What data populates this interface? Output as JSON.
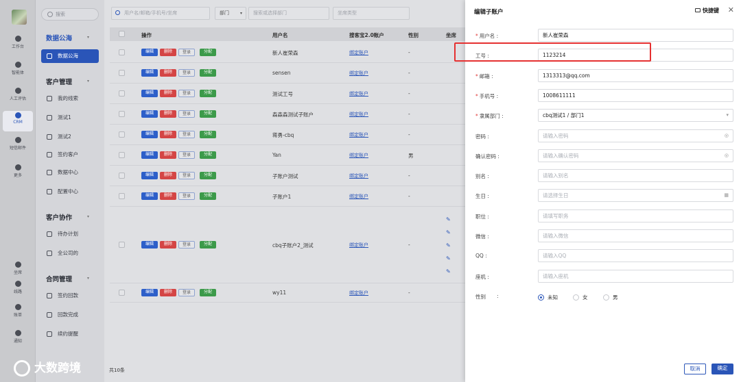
{
  "rail": {
    "items": [
      {
        "label": "工作台",
        "icon": "workbench-icon"
      },
      {
        "label": "智能体",
        "icon": "agent-icon"
      },
      {
        "label": "人工评估",
        "icon": "review-icon"
      },
      {
        "label": "CRM",
        "icon": "crm-icon"
      },
      {
        "label": "短信邮件",
        "icon": "message-icon"
      },
      {
        "label": "更多",
        "icon": "more-icon"
      },
      {
        "label": "坐席",
        "icon": "headset-icon"
      },
      {
        "label": "线路",
        "icon": "route-icon"
      },
      {
        "label": "账单",
        "icon": "bill-icon"
      },
      {
        "label": "通知",
        "icon": "bell-icon"
      }
    ]
  },
  "nav": {
    "search_placeholder": "搜索",
    "sections": [
      {
        "title": "数据公海",
        "items": [
          "数据公海"
        ]
      },
      {
        "title": "客户管理",
        "items": [
          "我的线索",
          "测试1",
          "测试2",
          "签约客户",
          "数据中心",
          "配置中心"
        ]
      },
      {
        "title": "客户协作",
        "items": [
          "待办计划",
          "全公司的"
        ]
      },
      {
        "title": "合同管理",
        "items": [
          "签约回款",
          "回款完成",
          "续约提醒"
        ]
      }
    ]
  },
  "filters": {
    "user_placeholder": "用户名/邮箱/手机号/坐席",
    "dept_label": "部门",
    "dept_placeholder": "搜索或选择部门",
    "seat_placeholder": "坐席类型"
  },
  "table": {
    "headers": [
      "操作",
      "用户名",
      "搜客宝2.0账户",
      "性别",
      "坐席"
    ],
    "buttons": {
      "edit": "编辑",
      "delete": "删除",
      "login": "登录",
      "assign": "分配"
    },
    "rows": [
      {
        "username": "新人崔荣森",
        "account": "绑定账户",
        "gender": "-"
      },
      {
        "username": "sensen",
        "account": "绑定账户",
        "gender": "-"
      },
      {
        "username": "测试工号",
        "account": "绑定账户",
        "gender": "-"
      },
      {
        "username": "森森森测试子账户",
        "account": "绑定账户",
        "gender": "-"
      },
      {
        "username": "蒋勇-cbq",
        "account": "绑定账户",
        "gender": "-"
      },
      {
        "username": "Yan",
        "account": "绑定账户",
        "gender": "男"
      },
      {
        "username": "子账户测试",
        "account": "绑定账户",
        "gender": "-"
      },
      {
        "username": "子账户1",
        "account": "绑定账户",
        "gender": "-"
      },
      {
        "username": "cbq子账户2_测试",
        "account": "绑定账户",
        "gender": "-"
      },
      {
        "username": "wy11",
        "account": "绑定账户",
        "gender": "-"
      }
    ],
    "total": "共10条"
  },
  "drawer": {
    "title": "编辑子账户",
    "quick_key": "快捷键",
    "fields": [
      {
        "label": "用户名",
        "required": true,
        "value": "新人崔荣森",
        "placeholder": ""
      },
      {
        "label": "工号",
        "required": false,
        "value": "1123214",
        "placeholder": ""
      },
      {
        "label": "邮箱",
        "required": true,
        "value": "1313313@qq.com",
        "placeholder": ""
      },
      {
        "label": "手机号",
        "required": true,
        "value": "1008611111",
        "placeholder": ""
      },
      {
        "label": "隶属部门",
        "required": true,
        "value": "cbq测试1 / 部门1",
        "placeholder": ""
      },
      {
        "label": "密码",
        "required": false,
        "value": "",
        "placeholder": "请输入密码"
      },
      {
        "label": "确认密码",
        "required": false,
        "value": "",
        "placeholder": "请输入确认密码"
      },
      {
        "label": "别名",
        "required": false,
        "value": "",
        "placeholder": "请输入别名"
      },
      {
        "label": "生日",
        "required": false,
        "value": "",
        "placeholder": "请选择生日"
      },
      {
        "label": "职位",
        "required": false,
        "value": "",
        "placeholder": "请填写职务"
      },
      {
        "label": "微信",
        "required": false,
        "value": "",
        "placeholder": "请输入微信"
      },
      {
        "label": "QQ",
        "required": false,
        "value": "",
        "placeholder": "请输入QQ"
      },
      {
        "label": "座机",
        "required": false,
        "value": "",
        "placeholder": "请输入座机"
      }
    ],
    "gender_label": "性别",
    "gender_options": [
      "未知",
      "女",
      "男"
    ],
    "gender_selected": "未知",
    "cancel": "取消",
    "confirm": "确定"
  },
  "colors": {
    "accent": "#2a55b8",
    "highlight": "#e53030"
  },
  "watermark": "大数跨境"
}
